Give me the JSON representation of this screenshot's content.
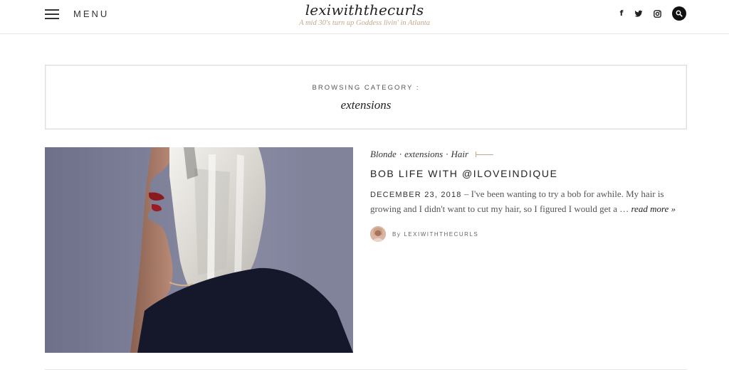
{
  "header": {
    "menu_label": "MENU",
    "site_title": "lexiwiththecurls",
    "tagline": "A mid 30's turn up Goddess livin' in Atlanta",
    "social": [
      {
        "icon": "facebook-icon",
        "glyph": "f"
      },
      {
        "icon": "twitter-icon",
        "glyph": "🐦"
      },
      {
        "icon": "instagram-icon",
        "glyph": "◎"
      }
    ],
    "search_icon": "search-icon"
  },
  "category": {
    "label": "BROWSING CATEGORY :",
    "name": "extensions"
  },
  "post": {
    "tags": [
      "Blonde",
      "extensions",
      "Hair"
    ],
    "tag_separator": "·",
    "title": "BOB LIFE WITH @ILOVEINDIQUE",
    "date": "DECEMBER 23, 2018",
    "date_dash": " – ",
    "excerpt": "I've been wanting to try a bob for awhile. My hair is growing and I didn't want to cut my hair, so I figured I would get a … ",
    "read_more": "read more »",
    "author_prefix": "By",
    "author": "LEXIWITHTHECURLS"
  },
  "colors": {
    "accent": "#c4a88d",
    "text": "#333333"
  }
}
